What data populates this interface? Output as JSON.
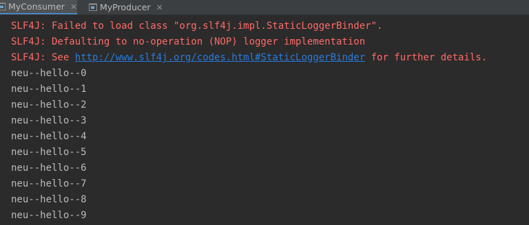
{
  "tabs": [
    {
      "label": "MyConsumer",
      "icon": "console-icon",
      "active": true
    },
    {
      "label": "MyProducer",
      "icon": "console-icon",
      "active": false
    }
  ],
  "console": {
    "errors": {
      "line1": "SLF4J: Failed to load class \"org.slf4j.impl.StaticLoggerBinder\".",
      "line2": "SLF4J: Defaulting to no-operation (NOP) logger implementation",
      "line3_prefix": "SLF4J: See ",
      "line3_link": "http://www.slf4j.org/codes.html#StaticLoggerBinder",
      "line3_suffix": " for further details."
    },
    "output": [
      "neu--hello--0",
      "neu--hello--1",
      "neu--hello--2",
      "neu--hello--3",
      "neu--hello--4",
      "neu--hello--5",
      "neu--hello--6",
      "neu--hello--7",
      "neu--hello--8",
      "neu--hello--9"
    ]
  },
  "colors": {
    "background": "#2b2b2b",
    "error_text": "#ff6b68",
    "link_text": "#287bde",
    "normal_text": "#bbbbbb"
  }
}
